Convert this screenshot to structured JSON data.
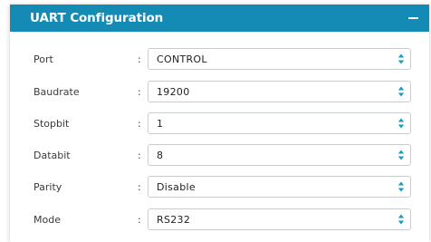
{
  "panel": {
    "title": "UART Configuration",
    "collapse_icon": "minus-icon",
    "header_color": "#138bb4"
  },
  "fields": [
    {
      "label": "Port",
      "separator": ":",
      "value": "CONTROL",
      "icon": "select-arrows-icon"
    },
    {
      "label": "Baudrate",
      "separator": ":",
      "value": "19200",
      "icon": "select-arrows-icon"
    },
    {
      "label": "Stopbit",
      "separator": ":",
      "value": "1",
      "icon": "select-arrows-icon"
    },
    {
      "label": "Databit",
      "separator": ":",
      "value": "8",
      "icon": "select-arrows-icon"
    },
    {
      "label": "Parity",
      "separator": ":",
      "value": "Disable",
      "icon": "select-arrows-icon"
    },
    {
      "label": "Mode",
      "separator": ":",
      "value": "RS232",
      "icon": "select-arrows-icon"
    }
  ]
}
